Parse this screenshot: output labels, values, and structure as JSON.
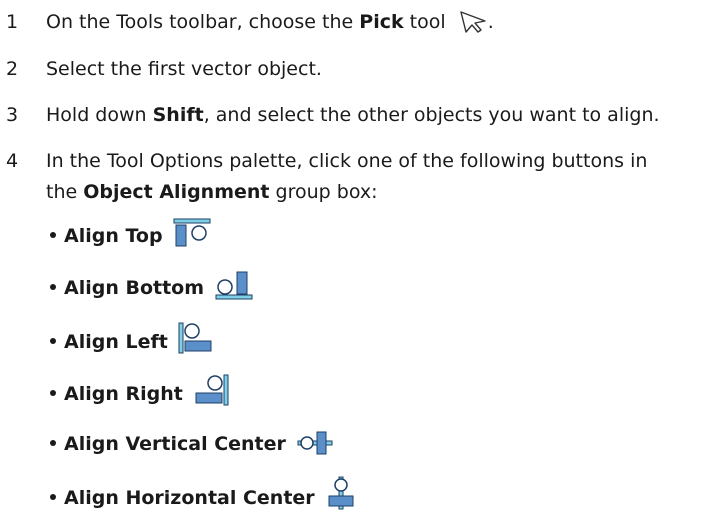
{
  "steps": [
    {
      "num": "1",
      "pre": "On the Tools toolbar, choose the ",
      "bold": "Pick",
      "post": " tool",
      "end": "."
    },
    {
      "num": "2",
      "text": "Select the first vector object."
    },
    {
      "num": "3",
      "pre": "Hold down ",
      "bold": "Shift",
      "post": ", and select the other objects you want to align."
    },
    {
      "num": "4",
      "line1": "In the Tool Options palette, click one of the following buttons in",
      "line2_pre": "the ",
      "line2_bold": "Object Alignment",
      "line2_post": " group box:"
    }
  ],
  "bullets": [
    {
      "label": "Align Top",
      "icon": "align-top-icon"
    },
    {
      "label": "Align Bottom",
      "icon": "align-bottom-icon"
    },
    {
      "label": "Align Left",
      "icon": "align-left-icon"
    },
    {
      "label": "Align Right",
      "icon": "align-right-icon"
    },
    {
      "label": "Align Vertical Center",
      "icon": "align-vertical-center-icon"
    },
    {
      "label": "Align Horizontal Center",
      "icon": "align-horizontal-center-icon"
    }
  ],
  "icon_colors": {
    "fill": "#5b8fc9",
    "light": "#7fd0e6",
    "stroke": "#1f3f66"
  }
}
